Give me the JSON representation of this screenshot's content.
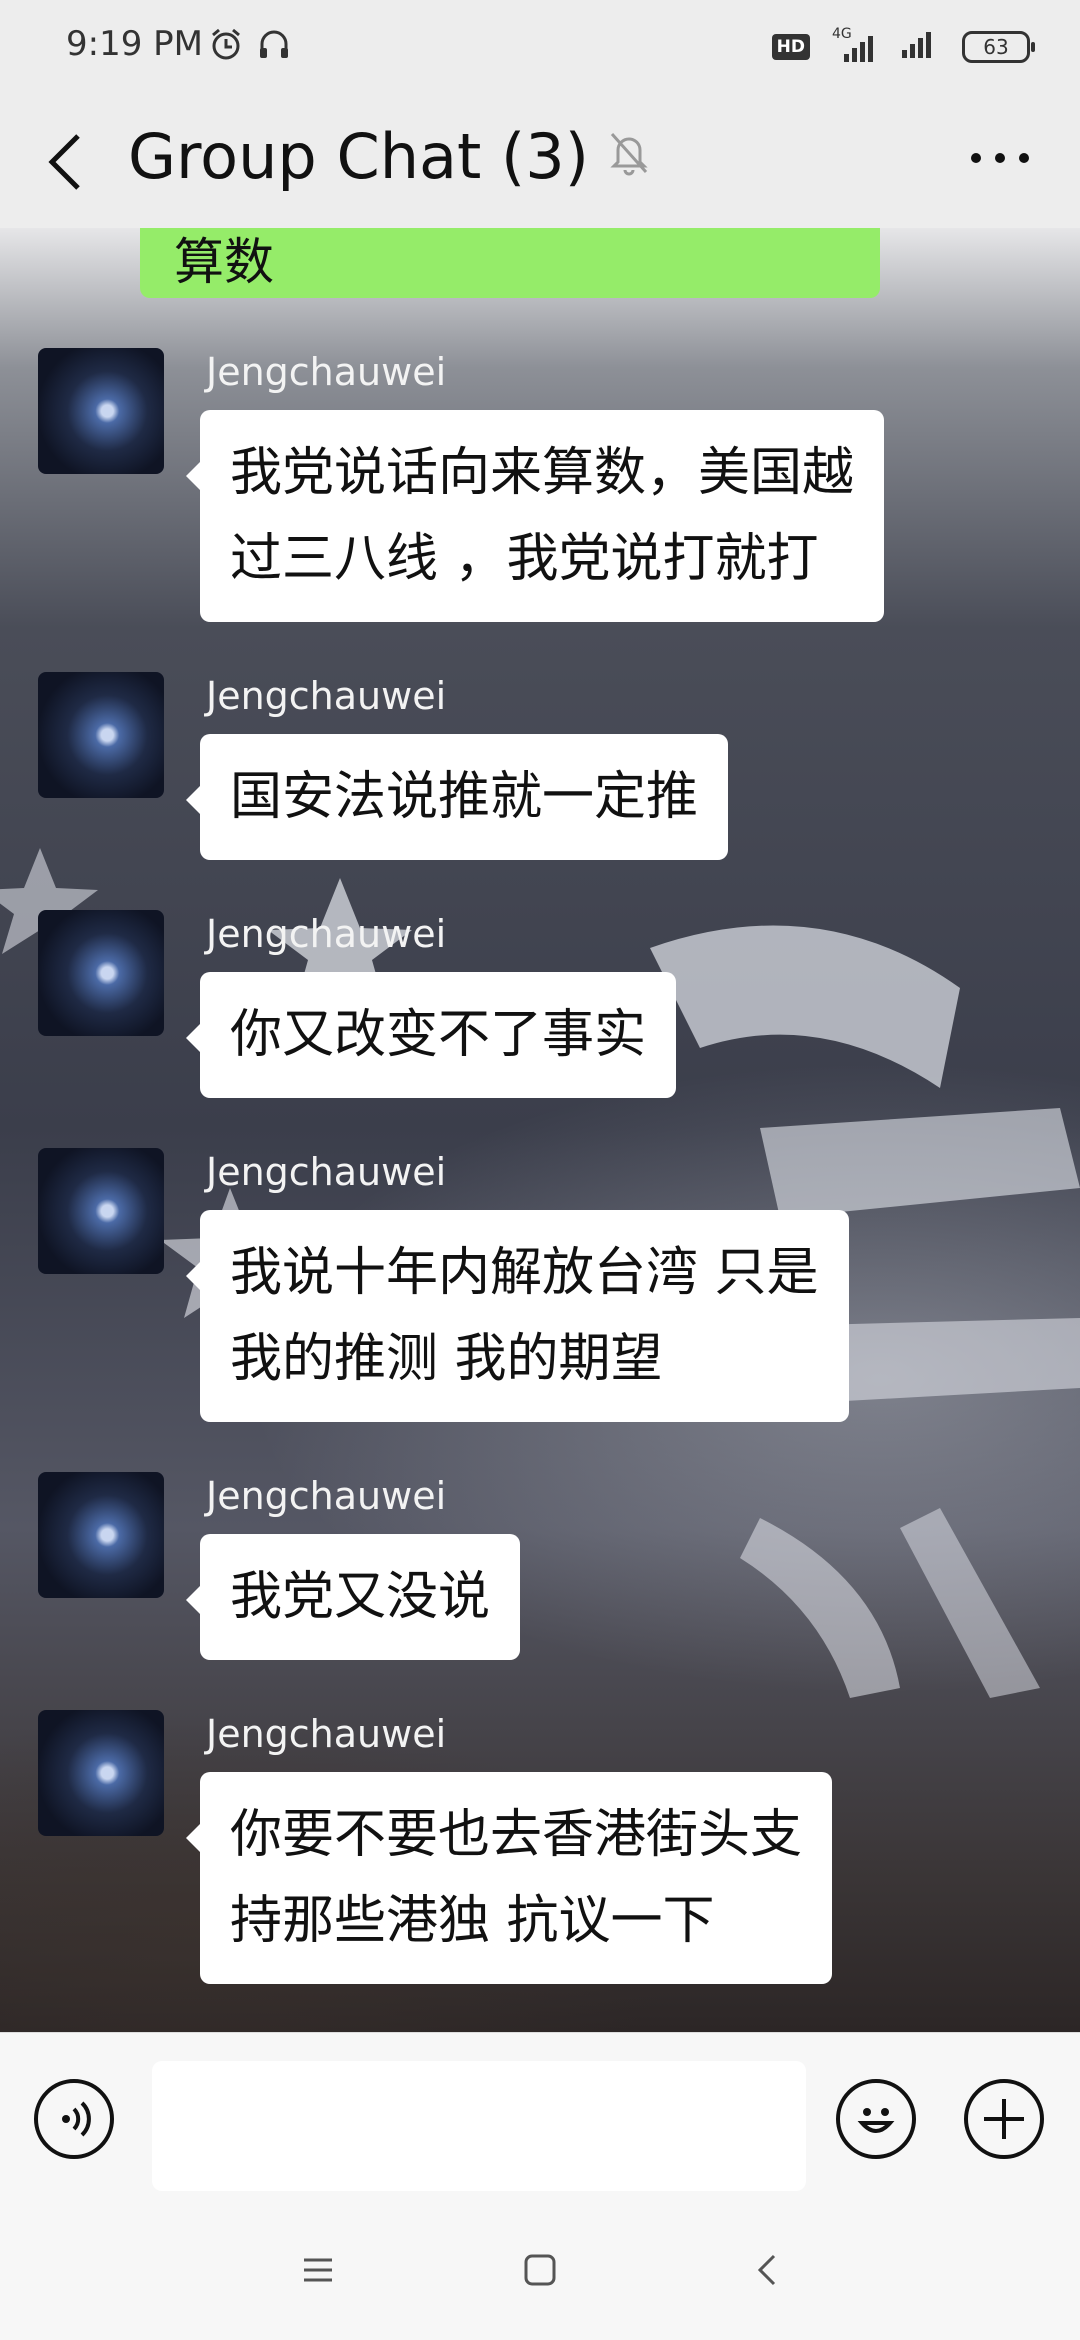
{
  "status_bar": {
    "time": "9:19 PM",
    "hd_badge": "HD",
    "network": "4G",
    "battery": "63"
  },
  "header": {
    "title": "Group Chat (3)",
    "back_icon": "chevron-left-icon",
    "mute_icon": "muted-bell-icon",
    "more_icon": "more-dots-icon"
  },
  "chat": {
    "partial_sent_message": "算数",
    "messages": [
      {
        "sender": "Jengchauwei",
        "text_lines": [
          "我党说话向来算数，美国越",
          "过三八线 ，我党说打就打"
        ]
      },
      {
        "sender": "Jengchauwei",
        "text_lines": [
          "国安法说推就一定推"
        ]
      },
      {
        "sender": "Jengchauwei",
        "text_lines": [
          "你又改变不了事实"
        ]
      },
      {
        "sender": "Jengchauwei",
        "text_lines": [
          "我说十年内解放台湾 只是",
          "我的推测 我的期望"
        ]
      },
      {
        "sender": "Jengchauwei",
        "text_lines": [
          "我党又没说"
        ]
      },
      {
        "sender": "Jengchauwei",
        "text_lines": [
          "你要不要也去香港街头支",
          "持那些港独 抗议一下"
        ]
      }
    ]
  },
  "input_bar": {
    "voice_icon": "voice-icon",
    "message_value": "",
    "emoji_icon": "emoji-icon",
    "add_icon": "plus-icon"
  },
  "nav_bar": {
    "menu_icon": "menu-icon",
    "home_icon": "home-square-icon",
    "back_icon": "back-triangle-icon"
  },
  "colors": {
    "sent_bubble": "#95ec69",
    "received_bubble": "#ffffff",
    "chrome": "#ededed"
  }
}
